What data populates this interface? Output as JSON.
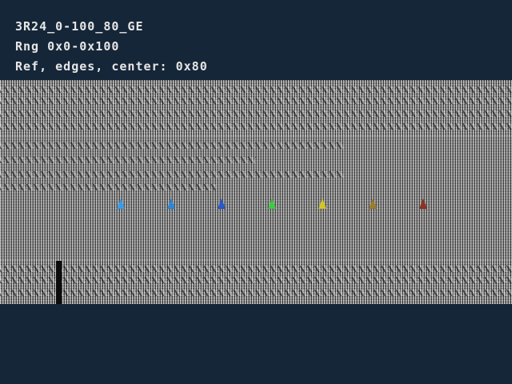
{
  "header": {
    "line1": "3R24_0-100_80_GE",
    "line2": "Rng 0x0-0x100",
    "line3": "Ref, edges, center: 0x80"
  },
  "markers": [
    {
      "name": "marker-1",
      "color": "#3a9ce8"
    },
    {
      "name": "marker-2",
      "color": "#2f86d6"
    },
    {
      "name": "marker-3",
      "color": "#2a58c8"
    },
    {
      "name": "marker-4",
      "color": "#3ecc3e"
    },
    {
      "name": "marker-5",
      "color": "#d4c42a"
    },
    {
      "name": "marker-6",
      "color": "#9a7c2e"
    },
    {
      "name": "marker-7",
      "color": "#8a3424"
    }
  ],
  "colors": {
    "background": "#152638",
    "text": "#e6e6e6",
    "pattern_base": "#7c7c7c"
  }
}
